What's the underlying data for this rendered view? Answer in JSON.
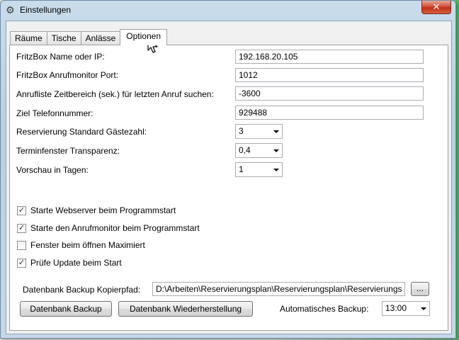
{
  "window": {
    "title": "Einstellungen",
    "icon": "gear-icon",
    "close_label": "✕"
  },
  "tabs": [
    {
      "label": "Räume",
      "active": false
    },
    {
      "label": "Tische",
      "active": false
    },
    {
      "label": "Anlässe",
      "active": false
    },
    {
      "label": "Optionen",
      "active": true
    }
  ],
  "fields": {
    "fritzbox_name": {
      "label": "FritzBox Name oder IP:",
      "value": "192.168.20.105"
    },
    "fritzbox_port": {
      "label": "FritzBox Anrufmonitor Port:",
      "value": "1012"
    },
    "anrufliste_zeitbereich": {
      "label": "Anrufliste Zeitbereich (sek.) für letzten Anruf suchen:",
      "value": "-3600"
    },
    "ziel_telefonnummer": {
      "label": "Ziel Telefonnummer:",
      "value": "929488"
    },
    "standard_gaestezahl": {
      "label": "Reservierung Standard Gästezahl:",
      "value": "3"
    },
    "terminfenster_transparenz": {
      "label": "Terminfenster Transparenz:",
      "value": "0,4"
    },
    "vorschau_tage": {
      "label": "Vorschau in Tagen:",
      "value": "1"
    }
  },
  "checkboxes": [
    {
      "label": "Starte Webserver beim Programmstart",
      "checked": true
    },
    {
      "label": "Starte den Anrufmonitor beim Programmstart",
      "checked": true
    },
    {
      "label": "Fenster beim öffnen Maximiert",
      "checked": false
    },
    {
      "label": "Prüfe Update beim Start",
      "checked": true
    }
  ],
  "backup": {
    "path_label": "Datenbank Backup Kopierpfad:",
    "path_value": "D:\\Arbeiten\\Reservierungsplan\\Reservierungsplan\\Reservierungs",
    "browse_label": "...",
    "backup_button": "Datenbank Backup",
    "restore_button": "Datenbank Wiederherstellung",
    "auto_label": "Automatisches Backup:",
    "auto_value": "13:00"
  },
  "check_mark": "✓"
}
